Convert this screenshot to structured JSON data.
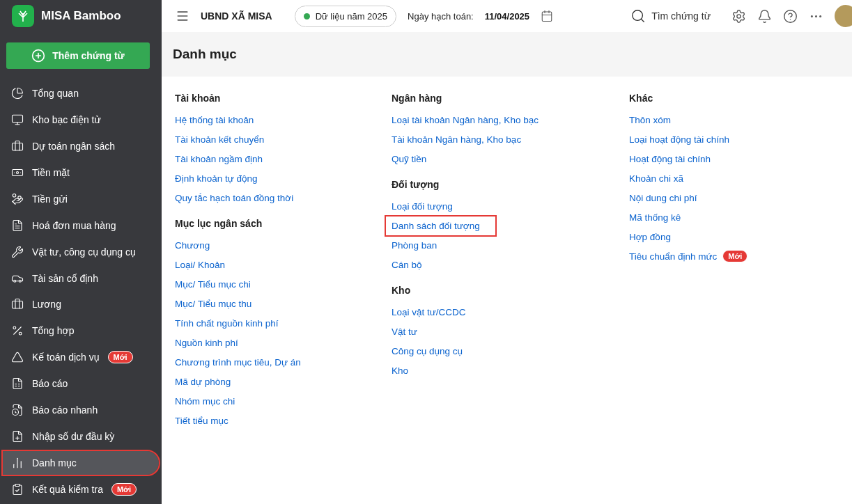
{
  "app": {
    "name": "MISA Bamboo",
    "add_button": "Thêm chứng từ"
  },
  "sidebar": {
    "items": [
      {
        "label": "Tổng quan",
        "selected": false,
        "highlighted": false
      },
      {
        "label": "Kho bạc điện tử",
        "selected": false,
        "highlighted": false
      },
      {
        "label": "Dự toán ngân sách",
        "selected": false,
        "highlighted": false
      },
      {
        "label": "Tiền mặt",
        "selected": false,
        "highlighted": false
      },
      {
        "label": "Tiền gửi",
        "selected": false,
        "highlighted": false
      },
      {
        "label": "Hoá đơn mua hàng",
        "selected": false,
        "highlighted": false
      },
      {
        "label": "Vật tư, công cụ dụng cụ",
        "selected": false,
        "highlighted": false
      },
      {
        "label": "Tài sản cố định",
        "selected": false,
        "highlighted": false
      },
      {
        "label": "Lương",
        "selected": false,
        "highlighted": false
      },
      {
        "label": "Tổng hợp",
        "selected": false,
        "highlighted": false
      },
      {
        "label": "Kế toán dịch vụ",
        "badge": "Mới",
        "selected": false,
        "highlighted": false
      },
      {
        "label": "Báo cáo",
        "selected": false,
        "highlighted": false
      },
      {
        "label": "Báo cáo nhanh",
        "selected": false,
        "highlighted": false
      },
      {
        "label": "Nhập số dư đầu kỳ",
        "selected": false,
        "highlighted": false
      },
      {
        "label": "Danh mục",
        "selected": true,
        "highlighted": true
      },
      {
        "label": "Kết quả kiểm tra",
        "badge": "Mới",
        "selected": false,
        "highlighted": false
      }
    ]
  },
  "topbar": {
    "org": "UBND XÃ MISA",
    "data_year": "Dữ liệu năm 2025",
    "posting_date_label": "Ngày hạch toán:",
    "posting_date": "11/04/2025",
    "search_placeholder": "Tìm chứng từ"
  },
  "page": {
    "title": "Danh mục",
    "columns": [
      {
        "groups": [
          {
            "heading": "Tài khoản",
            "links": [
              {
                "label": "Hệ thống tài khoản",
                "highlighted": false
              },
              {
                "label": "Tài khoản kết chuyển",
                "highlighted": false
              },
              {
                "label": "Tài khoản ngầm định",
                "highlighted": false
              },
              {
                "label": "Định khoản tự động",
                "highlighted": false
              },
              {
                "label": "Quy tắc hạch toán đồng thời",
                "highlighted": false
              }
            ]
          },
          {
            "heading": "Mục lục ngân sách",
            "links": [
              {
                "label": "Chương",
                "highlighted": false
              },
              {
                "label": "Loại/ Khoản",
                "highlighted": false
              },
              {
                "label": "Mục/ Tiểu mục chi",
                "highlighted": false
              },
              {
                "label": "Mục/ Tiểu mục thu",
                "highlighted": false
              },
              {
                "label": "Tính chất nguồn kinh phí",
                "highlighted": false
              },
              {
                "label": "Nguồn kinh phí",
                "highlighted": false
              },
              {
                "label": "Chương trình mục tiêu, Dự án",
                "highlighted": false
              },
              {
                "label": "Mã dự phòng",
                "highlighted": false
              },
              {
                "label": "Nhóm mục chi",
                "highlighted": false
              },
              {
                "label": "Tiết tiểu mục",
                "highlighted": false
              }
            ]
          }
        ]
      },
      {
        "groups": [
          {
            "heading": "Ngân hàng",
            "links": [
              {
                "label": "Loại tài khoản Ngân hàng, Kho bạc",
                "highlighted": false
              },
              {
                "label": "Tài khoản Ngân hàng, Kho bạc",
                "highlighted": false
              },
              {
                "label": "Quỹ tiền",
                "highlighted": false
              }
            ]
          },
          {
            "heading": "Đối tượng",
            "links": [
              {
                "label": "Loại đối tượng",
                "highlighted": false
              },
              {
                "label": "Danh sách đối tượng",
                "highlighted": true
              },
              {
                "label": "Phòng ban",
                "highlighted": false
              },
              {
                "label": "Cán bộ",
                "highlighted": false
              }
            ]
          },
          {
            "heading": "Kho",
            "links": [
              {
                "label": "Loại vật tư/CCDC",
                "highlighted": false
              },
              {
                "label": "Vật tư",
                "highlighted": false
              },
              {
                "label": "Công cụ dụng cụ",
                "highlighted": false
              },
              {
                "label": "Kho",
                "highlighted": false
              }
            ]
          }
        ]
      },
      {
        "groups": [
          {
            "heading": "Khác",
            "links": [
              {
                "label": "Thôn xóm",
                "highlighted": false
              },
              {
                "label": "Loại hoạt động tài chính",
                "highlighted": false
              },
              {
                "label": "Hoạt động tài chính",
                "highlighted": false
              },
              {
                "label": "Khoản chi xã",
                "highlighted": false
              },
              {
                "label": "Nội dung chi phí",
                "highlighted": false
              },
              {
                "label": "Mã thống kê",
                "highlighted": false
              },
              {
                "label": "Hợp đồng",
                "highlighted": false
              },
              {
                "label": "Tiêu chuẩn định mức",
                "badge": "Mới",
                "highlighted": false
              }
            ]
          }
        ]
      }
    ]
  }
}
